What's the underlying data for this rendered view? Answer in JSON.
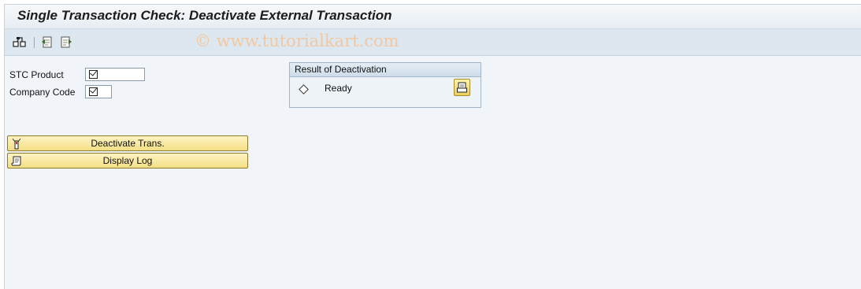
{
  "title": "Single Transaction Check: Deactivate External Transaction",
  "watermark": "© www.tutorialkart.com",
  "toolbar": {
    "icons": [
      "execute-icon",
      "variant-icon",
      "get-variant-icon"
    ]
  },
  "fields": [
    {
      "label": "STC Product",
      "checked": true
    },
    {
      "label": "Company Code",
      "checked": true
    }
  ],
  "result_group": {
    "title": "Result of Deactivation",
    "status": "Ready"
  },
  "buttons": {
    "deactivate": "Deactivate Trans.",
    "display_log": "Display Log"
  },
  "colors": {
    "button_fill": "#f3df86",
    "toolbar_bg": "#dde7ef",
    "page_bg": "#f1f5f9"
  }
}
